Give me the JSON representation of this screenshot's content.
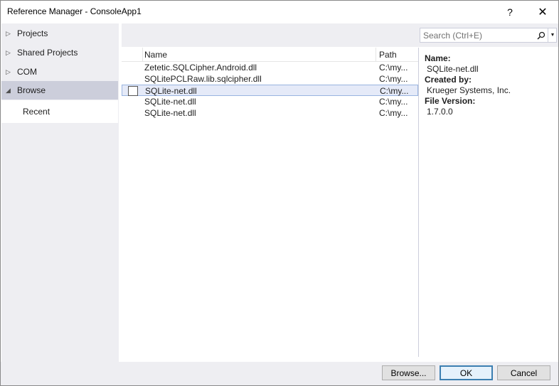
{
  "window": {
    "title": "Reference Manager - ConsoleApp1",
    "help_label": "?",
    "close_label": "✕"
  },
  "sidebar": {
    "items": [
      {
        "label": "Projects",
        "arrow": "▷"
      },
      {
        "label": "Shared Projects",
        "arrow": "▷"
      },
      {
        "label": "COM",
        "arrow": "▷"
      },
      {
        "label": "Browse",
        "arrow": "◢"
      }
    ],
    "sub_items": [
      {
        "label": "Recent"
      }
    ]
  },
  "search": {
    "placeholder": "Search (Ctrl+E)",
    "drop_glyph": "▼"
  },
  "list": {
    "columns": {
      "name": "Name",
      "path": "Path"
    },
    "rows": [
      {
        "name": "Zetetic.SQLCipher.Android.dll",
        "path": "C:\\my..."
      },
      {
        "name": "SQLitePCLRaw.lib.sqlcipher.dll",
        "path": "C:\\my..."
      },
      {
        "name": "SQLite-net.dll",
        "path": "C:\\my..."
      },
      {
        "name": "SQLite-net.dll",
        "path": "C:\\my..."
      },
      {
        "name": "SQLite-net.dll",
        "path": "C:\\my..."
      }
    ]
  },
  "details": {
    "name_label": "Name:",
    "name_value": "SQLite-net.dll",
    "created_label": "Created by:",
    "created_value": "Krueger Systems, Inc.",
    "version_label": "File Version:",
    "version_value": "1.7.0.0"
  },
  "footer": {
    "browse": "Browse...",
    "ok": "OK",
    "cancel": "Cancel"
  }
}
